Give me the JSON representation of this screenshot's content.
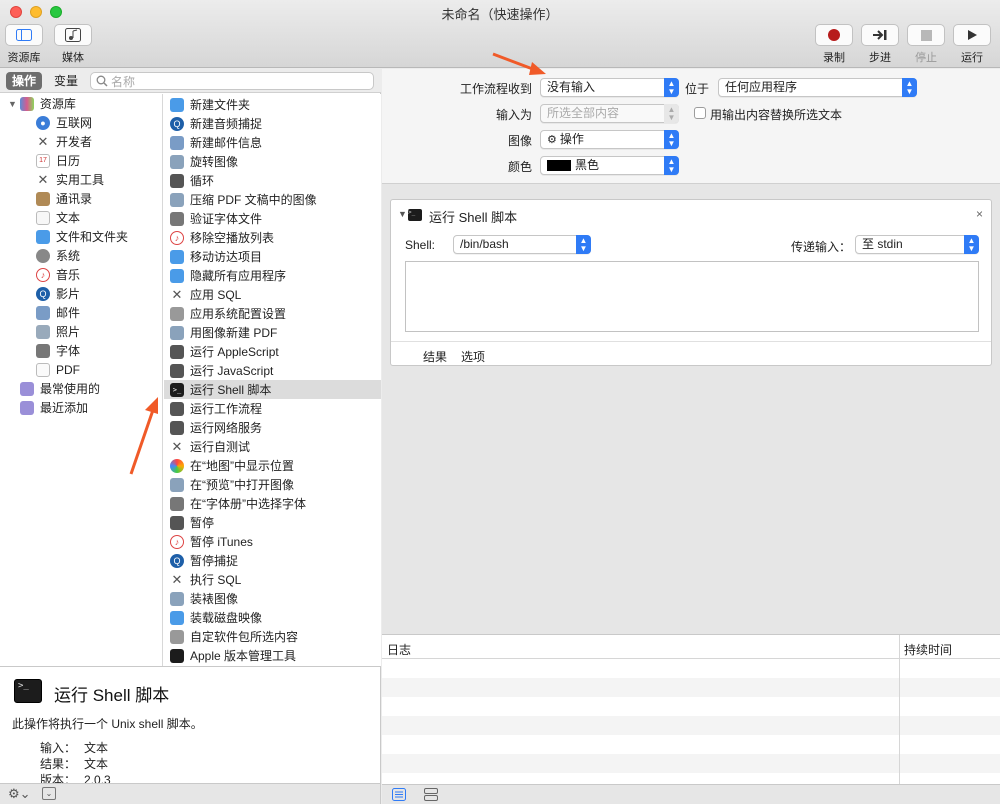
{
  "window": {
    "title": "未命名（快速操作）"
  },
  "toolbar": {
    "library_label": "资源库",
    "media_label": "媒体",
    "record_label": "录制",
    "step_label": "步进",
    "stop_label": "停止",
    "run_label": "运行"
  },
  "tabs": {
    "actions": "操作",
    "variables": "变量"
  },
  "search": {
    "placeholder": "名称"
  },
  "library": {
    "root": "资源库",
    "items": [
      "互联网",
      "开发者",
      "日历",
      "实用工具",
      "通讯录",
      "文本",
      "文件和文件夹",
      "系统",
      "音乐",
      "影片",
      "邮件",
      "照片",
      "字体",
      "PDF"
    ],
    "smart": [
      "最常使用的",
      "最近添加"
    ]
  },
  "actions": [
    "新建文件夹",
    "新建音频捕捉",
    "新建邮件信息",
    "旋转图像",
    "循环",
    "压缩 PDF 文稿中的图像",
    "验证字体文件",
    "移除空播放列表",
    "移动访达项目",
    "隐藏所有应用程序",
    "应用 SQL",
    "应用系统配置设置",
    "用图像新建 PDF",
    "运行 AppleScript",
    "运行 JavaScript",
    "运行 Shell 脚本",
    "运行工作流程",
    "运行网络服务",
    "运行自测试",
    "在“地图”中显示位置",
    "在“预览”中打开图像",
    "在“字体册”中选择字体",
    "暂停",
    "暂停 iTunes",
    "暂停捕捉",
    "执行 SQL",
    "装裱图像",
    "装载磁盘映像",
    "自定软件包所选内容",
    "Apple 版本管理工具"
  ],
  "description": {
    "title": "运行 Shell 脚本",
    "text": "此操作将执行一个 Unix shell 脚本。",
    "input_label": "输入：",
    "input_value": "文本",
    "result_label": "结果：",
    "result_value": "文本",
    "version_label": "版本：",
    "version_value": "2.0.3"
  },
  "workflow": {
    "receives_label": "工作流程收到",
    "receives_value": "没有输入",
    "in_label": "位于",
    "in_value": "任何应用程序",
    "input_is_label": "输入为",
    "input_is_value": "所选全部内容",
    "replace_label": "用输出内容替换所选文本",
    "image_label": "图像",
    "image_value": "操作",
    "color_label": "颜色",
    "color_value": "黑色",
    "color_swatch": "#000000"
  },
  "shell_action": {
    "title": "运行 Shell 脚本",
    "shell_label": "Shell:",
    "shell_value": "/bin/bash",
    "pass_label": "传递输入：",
    "pass_value": "至 stdin",
    "tab_results": "结果",
    "tab_options": "选项"
  },
  "log": {
    "col_log": "日志",
    "col_duration": "持续时间"
  },
  "colors": {
    "accent": "#2f7bf6",
    "arrow": "#f05a28",
    "record": "#b71c1c"
  }
}
